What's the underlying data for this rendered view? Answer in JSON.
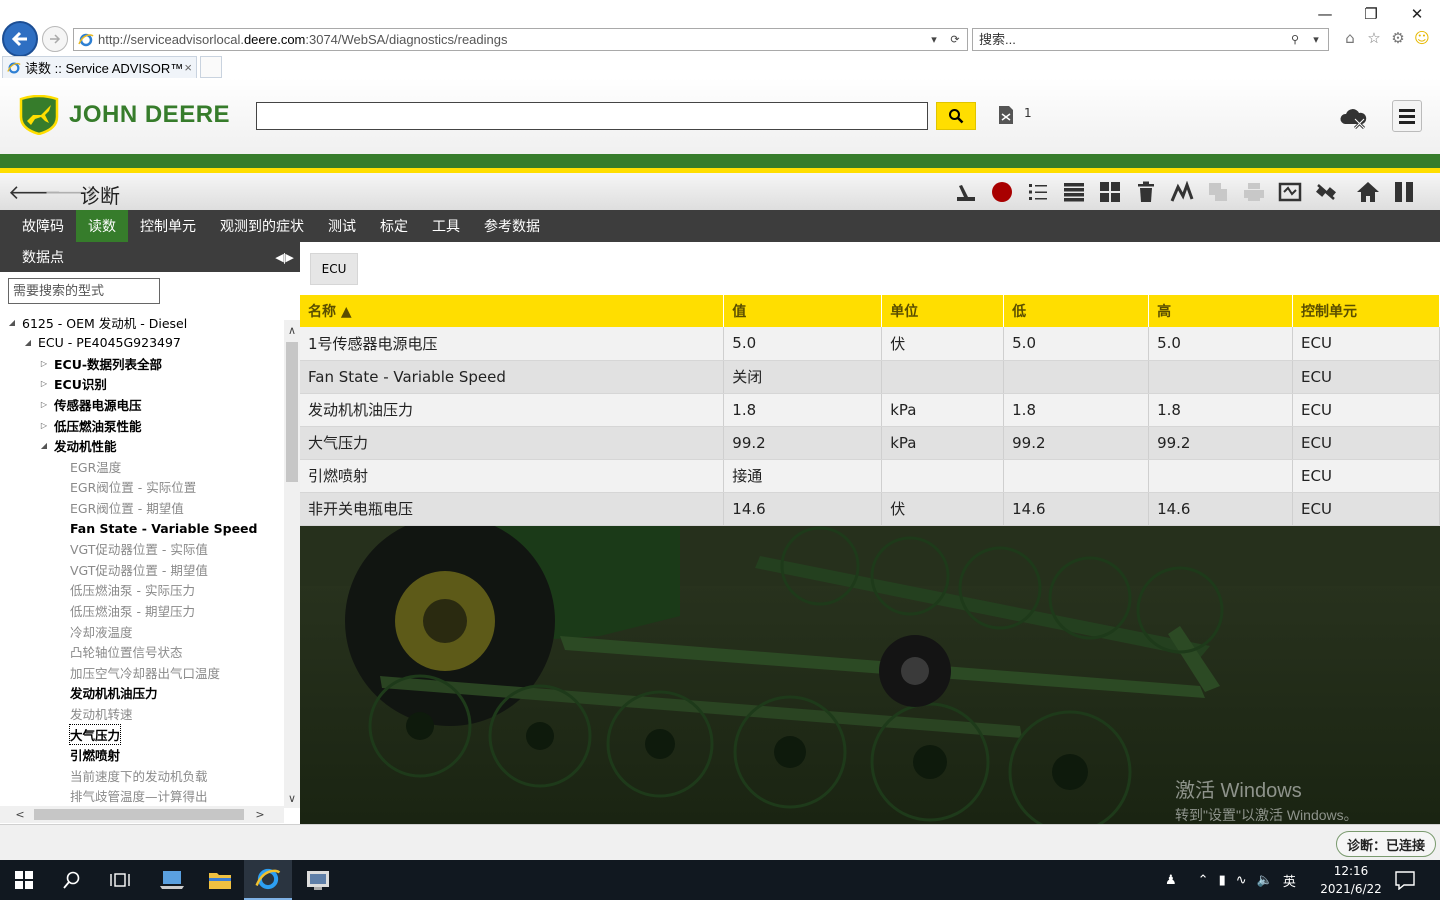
{
  "browser": {
    "url_prefix": "http://serviceadvisorlocal.",
    "url_domain": "deere.com",
    "url_suffix": ":3074/WebSA/diagnostics/readings",
    "search_placeholder": "搜索...",
    "tab_title": "读数 :: Service ADVISOR™",
    "tab_close": "×"
  },
  "header": {
    "brand": "JOHN DEERE",
    "case_count": "1",
    "colors": {
      "green": "#367c2b",
      "yellow": "#ffde00"
    }
  },
  "toolbar": {
    "back": "🡐",
    "forward": "🡒",
    "title": "诊断"
  },
  "tabs": [
    {
      "label": "故障码"
    },
    {
      "label": "读数",
      "active": true
    },
    {
      "label": "控制单元"
    },
    {
      "label": "观测到的症状"
    },
    {
      "label": "测试"
    },
    {
      "label": "标定"
    },
    {
      "label": "工具"
    },
    {
      "label": "参考数据"
    }
  ],
  "left_panel": {
    "title": "数据点",
    "search_placeholder": "需要搜索的型式",
    "tree": [
      {
        "label": "6125 - OEM 发动机 - Diesel",
        "level": 0,
        "arrow": "◢",
        "style": "normal"
      },
      {
        "label": "ECU - PE4045G923497",
        "level": 1,
        "arrow": "◢",
        "style": "normal"
      },
      {
        "label": "ECU-数据列表全部",
        "level": 2,
        "arrow": "▷",
        "style": "bold"
      },
      {
        "label": "ECU识别",
        "level": 2,
        "arrow": "▷",
        "style": "bold"
      },
      {
        "label": "传感器电源电压",
        "level": 2,
        "arrow": "▷",
        "style": "bold"
      },
      {
        "label": "低压燃油泵性能",
        "level": 2,
        "arrow": "▷",
        "style": "bold"
      },
      {
        "label": "发动机性能",
        "level": 2,
        "arrow": "◢",
        "style": "bold"
      },
      {
        "label": "EGR温度",
        "level": 3,
        "arrow": "",
        "style": "gray"
      },
      {
        "label": "EGR阀位置 - 实际位置",
        "level": 3,
        "arrow": "",
        "style": "gray"
      },
      {
        "label": "EGR阀位置 - 期望值",
        "level": 3,
        "arrow": "",
        "style": "gray"
      },
      {
        "label": "Fan State - Variable Speed",
        "level": 3,
        "arrow": "",
        "style": "bold"
      },
      {
        "label": "VGT促动器位置 - 实际值",
        "level": 3,
        "arrow": "",
        "style": "gray"
      },
      {
        "label": "VGT促动器位置 - 期望值",
        "level": 3,
        "arrow": "",
        "style": "gray"
      },
      {
        "label": "低压燃油泵 - 实际压力",
        "level": 3,
        "arrow": "",
        "style": "gray"
      },
      {
        "label": "低压燃油泵 - 期望压力",
        "level": 3,
        "arrow": "",
        "style": "gray"
      },
      {
        "label": "冷却液温度",
        "level": 3,
        "arrow": "",
        "style": "gray"
      },
      {
        "label": "凸轮轴位置信号状态",
        "level": 3,
        "arrow": "",
        "style": "gray"
      },
      {
        "label": "加压空气冷却器出气口温度",
        "level": 3,
        "arrow": "",
        "style": "gray"
      },
      {
        "label": "发动机机油压力",
        "level": 3,
        "arrow": "",
        "style": "bold"
      },
      {
        "label": "发动机转速",
        "level": 3,
        "arrow": "",
        "style": "gray"
      },
      {
        "label": "大气压力",
        "level": 3,
        "arrow": "",
        "style": "bold",
        "selected": true
      },
      {
        "label": "引燃喷射",
        "level": 3,
        "arrow": "",
        "style": "bold"
      },
      {
        "label": "当前速度下的发动机负载",
        "level": 3,
        "arrow": "",
        "style": "gray"
      },
      {
        "label": "排气歧管温度—计算得出",
        "level": 3,
        "arrow": "",
        "style": "gray"
      }
    ]
  },
  "main": {
    "chip": "ECU",
    "columns": [
      "名称 ▲",
      "值",
      "单位",
      "低",
      "高",
      "控制单元"
    ],
    "rows": [
      [
        "1号传感器电源电压",
        "5.0",
        "伏",
        "5.0",
        "5.0",
        "ECU"
      ],
      [
        "Fan State - Variable Speed",
        "关闭",
        "",
        "",
        "",
        "ECU"
      ],
      [
        "发动机机油压力",
        "1.8",
        "kPa",
        "1.8",
        "1.8",
        "ECU"
      ],
      [
        "大气压力",
        "99.2",
        "kPa",
        "99.2",
        "99.2",
        "ECU"
      ],
      [
        "引燃喷射",
        "接通",
        "",
        "",
        "",
        "ECU"
      ],
      [
        "非开关电瓶电压",
        "14.6",
        "伏",
        "14.6",
        "14.6",
        "ECU"
      ]
    ],
    "watermark_line1": "激活 Windows",
    "watermark_line2": "转到\"设置\"以激活 Windows。"
  },
  "status": {
    "text": "诊断：已连接"
  },
  "taskbar": {
    "ime": "英",
    "time": "12:16",
    "date": "2021/6/22"
  }
}
